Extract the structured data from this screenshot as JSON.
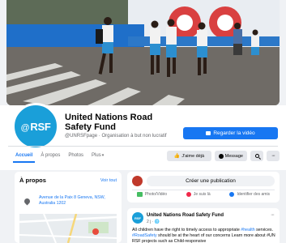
{
  "page": {
    "name": "United Nations Road Safety Fund",
    "handle": "@UNRSFpage",
    "category": "Organisation à but non lucratif",
    "avatar_text": "RSF",
    "avatar_prefix": "@"
  },
  "header": {
    "video_button": "Regarder la vidéo"
  },
  "tabs": [
    {
      "label": "Accueil",
      "active": true
    },
    {
      "label": "À propos"
    },
    {
      "label": "Photos"
    },
    {
      "label": "Plus"
    }
  ],
  "actions": {
    "like": "J'aime déjà",
    "message": "Message"
  },
  "about": {
    "title": "À propos",
    "see_all": "Voir tout",
    "address": "Avenue de la Paix 8 Geneva, NSW, Australia 1202"
  },
  "composer": {
    "create_post": "Créer une publication",
    "photo_video": "Photo/Vidéo",
    "here": "Je suis là",
    "tag_friends": "Identifier des amis"
  },
  "post": {
    "author": "United Nations Road Safety Fund",
    "time": "2 j",
    "text_a": "All children have the right to timely access to appropriate ",
    "tag1": "#health",
    "text_b": " services. ",
    "tag2": "#RoadSafety",
    "text_c": " should be at the heart of our concerns Learn more about #UN RSF projects such as Child-responsive"
  },
  "colors": {
    "brand": "#1877f2",
    "avatar_bg": "#1a9fd9",
    "page_bg": "#f0f2f5"
  }
}
